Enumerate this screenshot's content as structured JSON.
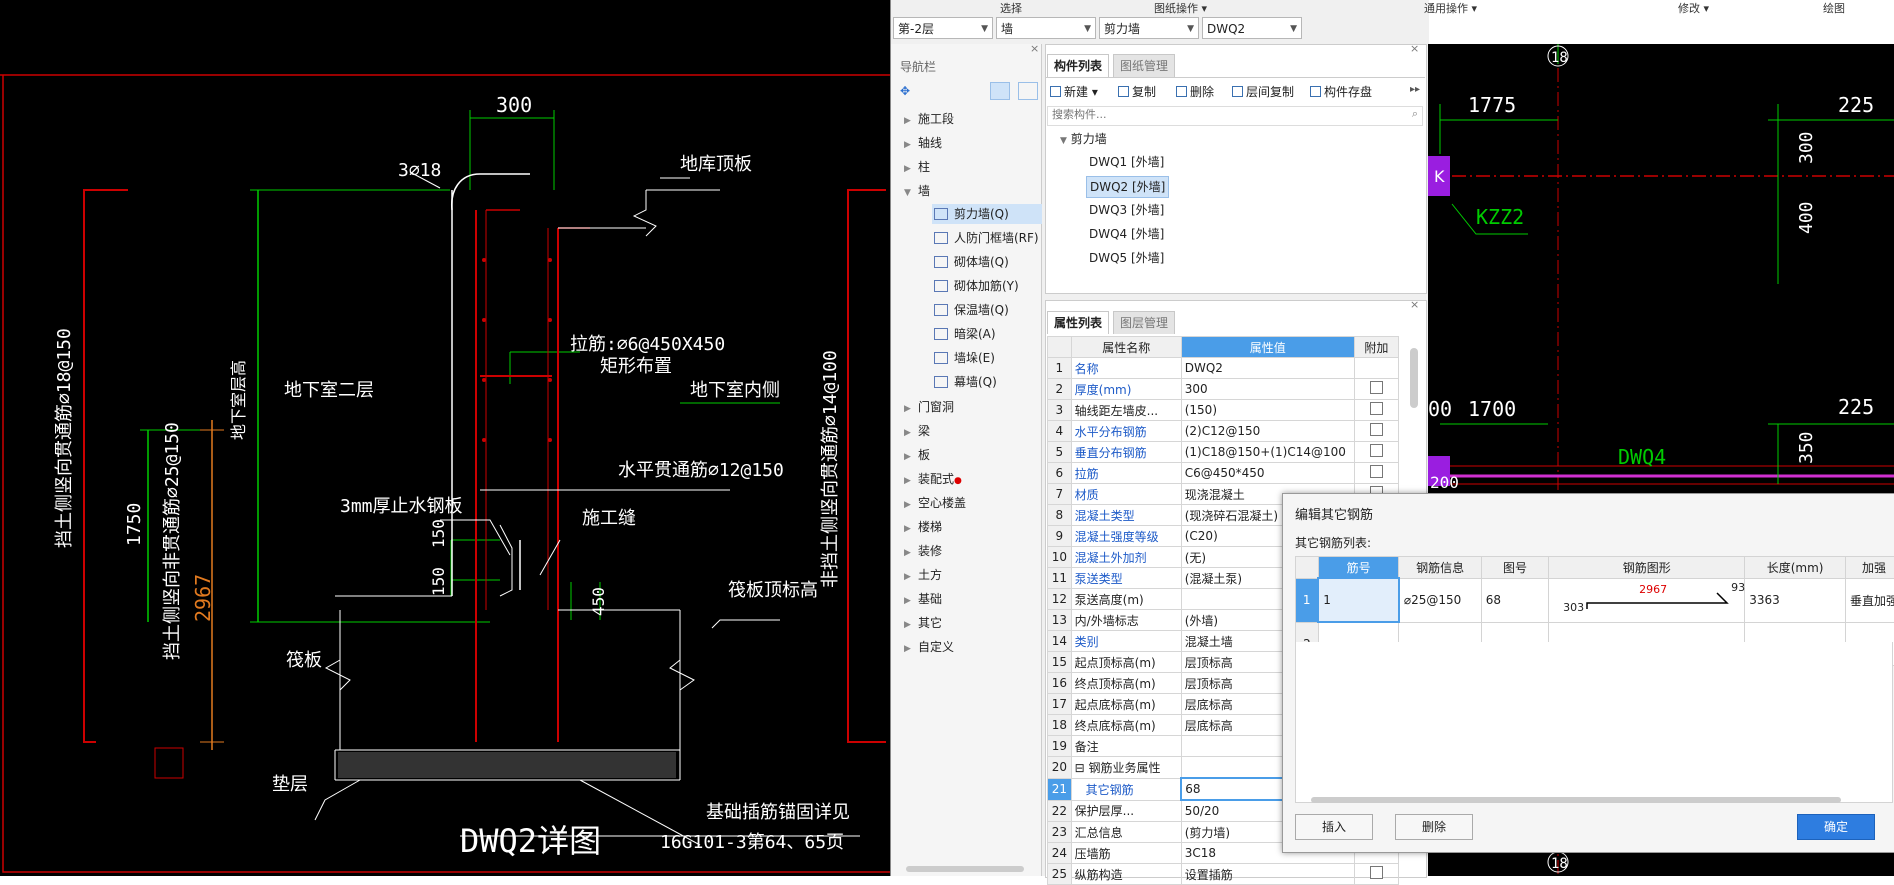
{
  "top_menu": [
    "选择",
    "图纸操作 ▾",
    "通用操作 ▾",
    "修改 ▾",
    "绘图"
  ],
  "selectors": [
    {
      "value": "第-2层"
    },
    {
      "value": "墙"
    },
    {
      "value": "剪力墙"
    },
    {
      "value": "DWQ2"
    }
  ],
  "nav": {
    "title": "导航栏",
    "items": [
      "施工段",
      "轴线",
      "柱",
      "墙",
      "门窗洞",
      "梁",
      "板",
      "装配式",
      "空心楼盖",
      "楼梯",
      "装修",
      "土方",
      "基础",
      "其它",
      "自定义"
    ],
    "wall_sub": [
      "剪力墙(Q)",
      "人防门框墙(RF)",
      "砌体墙(Q)",
      "砌体加筋(Y)",
      "保温墙(Q)",
      "暗梁(A)",
      "墙垛(E)",
      "幕墙(Q)"
    ]
  },
  "component_panel": {
    "tabs": [
      "构件列表",
      "图纸管理"
    ],
    "toolbar": [
      "新建",
      "复制",
      "删除",
      "层间复制",
      "构件存盘"
    ],
    "search_placeholder": "搜索构件...",
    "group": "剪力墙",
    "items": [
      "DWQ1 [外墙]",
      "DWQ2 [外墙]",
      "DWQ3 [外墙]",
      "DWQ4 [外墙]",
      "DWQ5 [外墙]"
    ]
  },
  "property_panel": {
    "tabs": [
      "属性列表",
      "图层管理"
    ],
    "headers": [
      "属性名称",
      "属性值",
      "附加"
    ],
    "rows": [
      {
        "n": "1",
        "name": "名称",
        "val": "DWQ2",
        "blue": true,
        "cb": false
      },
      {
        "n": "2",
        "name": "厚度(mm)",
        "val": "300",
        "blue": true,
        "cb": true
      },
      {
        "n": "3",
        "name": "轴线距左墙皮...",
        "val": "(150)",
        "blue": false,
        "cb": true
      },
      {
        "n": "4",
        "name": "水平分布钢筋",
        "val": "(2)C12@150",
        "blue": true,
        "cb": true
      },
      {
        "n": "5",
        "name": "垂直分布钢筋",
        "val": "(1)C18@150+(1)C14@100",
        "blue": true,
        "cb": true
      },
      {
        "n": "6",
        "name": "拉筋",
        "val": "C6@450*450",
        "blue": true,
        "cb": true
      },
      {
        "n": "7",
        "name": "材质",
        "val": "现浇混凝土",
        "blue": true,
        "cb": true
      },
      {
        "n": "8",
        "name": "混凝土类型",
        "val": "(现浇碎石混凝土)",
        "blue": true,
        "cb": true
      },
      {
        "n": "9",
        "name": "混凝土强度等级",
        "val": "(C20)",
        "blue": true,
        "cb": true
      },
      {
        "n": "10",
        "name": "混凝土外加剂",
        "val": "(无)",
        "blue": true,
        "cb": false
      },
      {
        "n": "11",
        "name": "泵送类型",
        "val": "(混凝土泵)",
        "blue": true,
        "cb": false
      },
      {
        "n": "12",
        "name": "泵送高度(m)",
        "val": "",
        "blue": false,
        "cb": false
      },
      {
        "n": "13",
        "name": "内/外墙标志",
        "val": "(外墙)",
        "blue": false,
        "cb": false
      },
      {
        "n": "14",
        "name": "类别",
        "val": "混凝土墙",
        "blue": true,
        "cb": false
      },
      {
        "n": "15",
        "name": "起点顶标高(m)",
        "val": "层顶标高",
        "blue": false,
        "cb": false
      },
      {
        "n": "16",
        "name": "终点顶标高(m)",
        "val": "层顶标高",
        "blue": false,
        "cb": false
      },
      {
        "n": "17",
        "name": "起点底标高(m)",
        "val": "层底标高",
        "blue": false,
        "cb": false
      },
      {
        "n": "18",
        "name": "终点底标高(m)",
        "val": "层底标高",
        "blue": false,
        "cb": false
      },
      {
        "n": "19",
        "name": "备注",
        "val": "",
        "blue": false,
        "cb": false
      },
      {
        "n": "20",
        "name": "⊟ 钢筋业务属性",
        "val": "",
        "blue": false,
        "cb": false
      },
      {
        "n": "21",
        "name": "其它钢筋",
        "val": "68",
        "blue": true,
        "cb": false
      },
      {
        "n": "22",
        "name": "保护层厚...",
        "val": "50/20",
        "blue": false,
        "cb": false
      },
      {
        "n": "23",
        "name": "汇总信息",
        "val": "(剪力墙)",
        "blue": false,
        "cb": false
      },
      {
        "n": "24",
        "name": "压墙筋",
        "val": "3C18",
        "blue": false,
        "cb": false
      },
      {
        "n": "25",
        "name": "纵筋构造",
        "val": "设置插筋",
        "blue": false,
        "cb": true
      }
    ]
  },
  "dialog": {
    "title": "编辑其它钢筋",
    "list_label": "其它钢筋列表:",
    "headers": [
      "筋号",
      "钢筋信息",
      "图号",
      "钢筋图形",
      "长度(mm)",
      "加强"
    ],
    "rows": [
      {
        "idx": "1",
        "bar_no": "1",
        "info": "⌀25@150",
        "fig": "68",
        "left": "303",
        "mid": "2967",
        "right": "93",
        "len": "3363",
        "extra": "垂直加强"
      },
      {
        "idx": "2",
        "bar_no": "",
        "info": "",
        "fig": "",
        "left": "",
        "mid": "",
        "right": "",
        "len": "",
        "extra": ""
      }
    ],
    "btn_insert": "插入",
    "btn_delete": "删除",
    "btn_ok": "确定"
  },
  "cad_left": {
    "labels": {
      "top_dim": "300",
      "rebar_top": "3⌀18",
      "roof_slab": "地库顶板",
      "tie_bar": "拉筋:⌀6@450X450",
      "rect": "矩形布置",
      "inner": "地下室内侧",
      "horiz": "水平贯通筋⌀12@150",
      "waterstop": "3mm厚止水钢板",
      "joint": "施工缝",
      "d150a": "150",
      "d150b": "150",
      "d450": "450",
      "raft_top": "筏板顶标高",
      "raft": "筏板",
      "cushion": "垫层",
      "anchor": "基础插筋锚固详见",
      "ref": "16G101-3第64、65页",
      "title": "DWQ2详图",
      "height_label": "地下室层高",
      "floor": "地下室二层",
      "left_v1": "挡土侧竖向贯通筋⌀18@150",
      "left_v2": "挡土侧竖向非贯通筋⌀25@150",
      "d1750": "1750",
      "d2967": "2967",
      "right_v": "非挡土侧竖向贯通筋⌀14@100"
    }
  },
  "cad_right": {
    "labels": {
      "axis_top": "18",
      "axis_bot": "18",
      "d1775": "1775",
      "d1700": "1700",
      "d225a": "225",
      "d225b": "225",
      "d300": "300",
      "d400": "400",
      "d350": "350",
      "d00": "00",
      "d200": "200",
      "kzz": "KZZ2",
      "dwq4": "DWQ4",
      "k": "K"
    }
  }
}
